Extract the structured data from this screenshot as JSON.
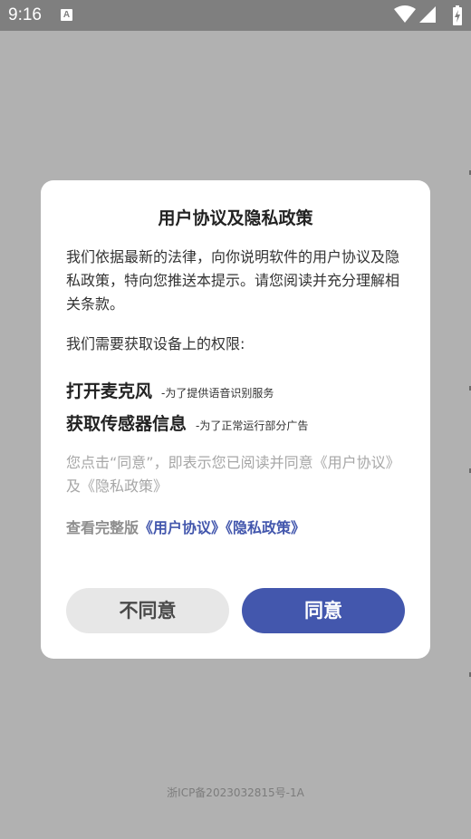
{
  "status_bar": {
    "time": "9:16",
    "notification_glyph": "A",
    "icons": [
      "wifi-icon",
      "signal-icon",
      "battery-icon"
    ]
  },
  "dialog": {
    "title": "用户协议及隐私政策",
    "intro": "我们依据最新的法律，向你说明软件的用户协议及隐私政策，特向您推送本提示。请您阅读并充分理解相关条款。",
    "permissions_heading": "我们需要获取设备上的权限:",
    "permissions": [
      {
        "name": "打开麦克风",
        "desc": "-为了提供语音识别服务"
      },
      {
        "name": "获取传感器信息",
        "desc": "-为了正常运行部分广告"
      }
    ],
    "consent_text": "您点击“同意”，即表示您已阅读并同意《用户协议》及《隐私政策》",
    "full_version_label": "查看完整版",
    "user_agreement_link": "《用户协议》",
    "privacy_policy_link": "《隐私政策》",
    "disagree_label": "不同意",
    "agree_label": "同意"
  },
  "footer": {
    "icp": "浙ICP备2023032815号-1A"
  },
  "colors": {
    "accent": "#4357ad",
    "overlay": "#b1b1b1",
    "status_bar": "#7f7f7f"
  }
}
